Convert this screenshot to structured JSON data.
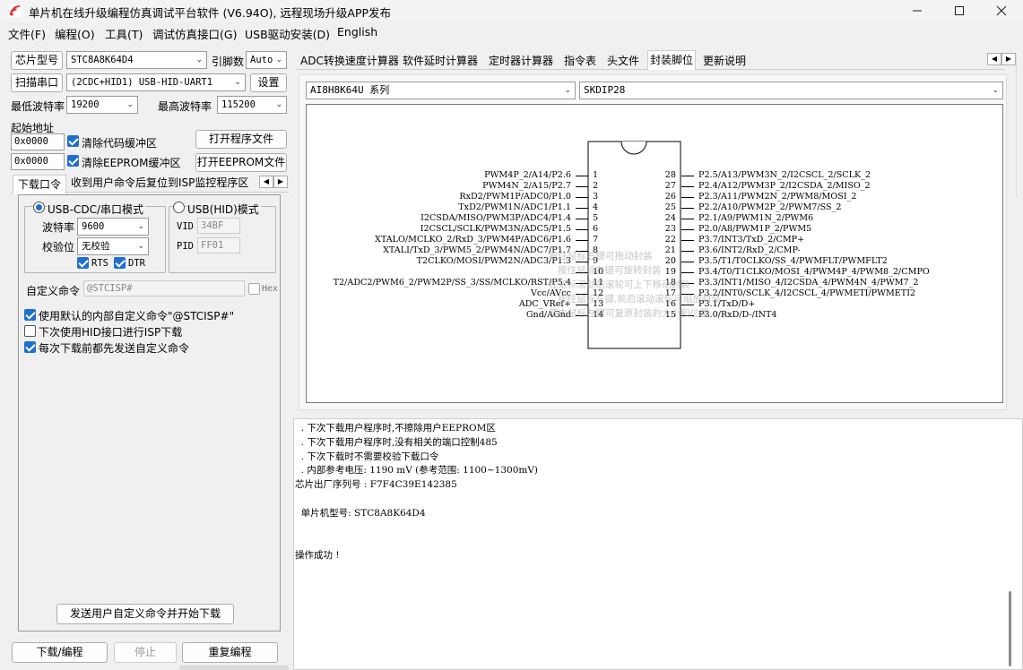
{
  "window": {
    "title": "单片机在线升级编程仿真调试平台软件 (V6.94O), 远程现场升级APP发布",
    "minimize_icon": "minimize-icon",
    "maximize_icon": "maximize-icon",
    "close_icon": "close-icon"
  },
  "menu": [
    "文件(F)",
    "编程(O)",
    "工具(T)",
    "调试仿真接口(G)",
    "USB驱动安装(D)",
    "English"
  ],
  "left": {
    "chip_label": "芯片型号",
    "chip_value": "STC8A8K64D4",
    "pin_label": "引脚数",
    "pin_value": "Auto",
    "scan_button": "扫描串口",
    "port_value": "(2CDC+HID1) USB-HID-UART1",
    "settings_button": "设置",
    "min_baud_label": "最低波特率",
    "min_baud_value": "19200",
    "max_baud_label": "最高波特率",
    "max_baud_value": "115200",
    "start_addr_label": "起始地址",
    "code_addr": "0x0000",
    "clear_code_label": "清除代码缓冲区",
    "open_prog_button": "打开程序文件",
    "eeprom_addr": "0x0000",
    "clear_eeprom_label": "清除EEPROM缓冲区",
    "open_eeprom_button": "打开EEPROM文件",
    "tab_download_port": "下载口令",
    "tab_isp_monitor": "收到用户命令后复位到ISP监控程序区",
    "cdc_mode_label": "USB-CDC/串口模式",
    "hid_mode_label": "USB(HID)模式",
    "baud_label": "波特率",
    "baud_value": "9600",
    "parity_label": "校验位",
    "parity_value": "无校验",
    "rts_label": "RTS",
    "dtr_label": "DTR",
    "vid_label": "VID",
    "vid_value": "34BF",
    "pid_label": "PID",
    "pid_value": "FF01",
    "custom_cmd_label": "自定义命令",
    "custom_cmd_value": "@STCISP#",
    "hex_label": "Hex",
    "opt1": "使用默认的内部自定义命令\"@STCISP#\"",
    "opt2": "下次使用HID接口进行ISP下载",
    "opt3": "每次下载前都先发送自定义命令",
    "send_button": "发送用户自定义命令并开始下载",
    "download_button": "下载/编程",
    "stop_button": "停止",
    "reprogram_button": "重复编程"
  },
  "right_tabs": [
    "ADC转换速度计算器",
    "软件延时计算器",
    "定时器计算器",
    "指令表",
    "头文件",
    "封装脚位",
    "更新说明"
  ],
  "active_tab_index": 5,
  "package": {
    "series_value": "AI8H8K64U 系列",
    "package_value": "SKDIP28",
    "left_pins": [
      {
        "num": "1",
        "label": "PWM4P_2/A14/P2.6"
      },
      {
        "num": "2",
        "label": "PWM4N_2/A15/P2.7"
      },
      {
        "num": "3",
        "label": "RxD2/PWM1P/ADC0/P1.0"
      },
      {
        "num": "4",
        "label": "TxD2/PWM1N/ADC1/P1.1"
      },
      {
        "num": "5",
        "label": "I2CSDA/MISO/PWM3P/ADC4/P1.4"
      },
      {
        "num": "6",
        "label": "I2CSCL/SCLK/PWM3N/ADC5/P1.5"
      },
      {
        "num": "7",
        "label": "XTALO/MCLKO_2/RxD_3/PWM4P/ADC6/P1.6"
      },
      {
        "num": "8",
        "label": "XTALI/TxD_3/PWM5_2/PWM4N/ADC7/P1.7"
      },
      {
        "num": "9",
        "label": "T2CLKO/MOSI/PWM2N/ADC3/P1.3"
      },
      {
        "num": "10",
        "label": ""
      },
      {
        "num": "11",
        "label": "T2/ADC2/PWM6_2/PWM2P/SS_3/SS/MCLKO/RST/P5.4"
      },
      {
        "num": "12",
        "label": "Vcc/AVcc"
      },
      {
        "num": "13",
        "label": "ADC_VRef+"
      },
      {
        "num": "14",
        "label": "Gnd/AGnd"
      }
    ],
    "right_pins": [
      {
        "num": "28",
        "label": "P2.5/A13/PWM3N_2/I2CSCL_2/SCLK_2"
      },
      {
        "num": "27",
        "label": "P2.4/A12/PWM3P_2/I2CSDA_2/MISO_2"
      },
      {
        "num": "26",
        "label": "P2.3/A11/PWM2N_2/PWM8/MOSI_2"
      },
      {
        "num": "25",
        "label": "P2.2/A10/PWM2P_2/PWM7/SS_2"
      },
      {
        "num": "24",
        "label": "P2.1/A9/PWM1N_2/PWM6"
      },
      {
        "num": "23",
        "label": "P2.0/A8/PWM1P_2/PWM5"
      },
      {
        "num": "22",
        "label": "P3.7/INT3/TxD_2/CMP+"
      },
      {
        "num": "21",
        "label": "P3.6/INT2/RxD_2/CMP-"
      },
      {
        "num": "20",
        "label": "P3.5/T1/T0CLKO/SS_4/PWMFLT/PWMFLT2"
      },
      {
        "num": "19",
        "label": "P3.4/T0/T1CLKO/MOSI_4/PWM4P_4/PWM8_2/CMPO"
      },
      {
        "num": "18",
        "label": "P3.3/INT1/MISO_4/I2CSDA_4/PWM4N_4/PWM7_2"
      },
      {
        "num": "17",
        "label": "P3.2/INT0/SCLK_4/I2CSCL_4/PWMETI/PWMETI2"
      },
      {
        "num": "16",
        "label": "P3.1/TxD/D+"
      },
      {
        "num": "15",
        "label": "P3.0/RxD/D-/INT4"
      }
    ],
    "overlay_hints": [
      "按住鼠标右键可拖动封装",
      "按住鼠标左键可旋转封装",
      "在鼠标滚动前滚轮可上下移动封装",
      "按住鼠标左键,前后滚动滚轮可缩放封装",
      "双击鼠标左键可复原封装的大小和位置"
    ]
  },
  "log": {
    "lines": [
      "  . 下次下载用户程序时,不擦除用户EEPROM区",
      "  . 下次下载用户程序时,没有相关的端口控制485",
      "  . 下次下载时不需要校验下载口令",
      "  . 内部参考电压: 1190 mV (参考范围: 1100~1300mV)",
      "芯片出厂序列号 : F7F4C39E142385",
      "",
      "  单片机型号: STC8A8K64D4",
      "",
      "",
      "操作成功 !"
    ]
  }
}
